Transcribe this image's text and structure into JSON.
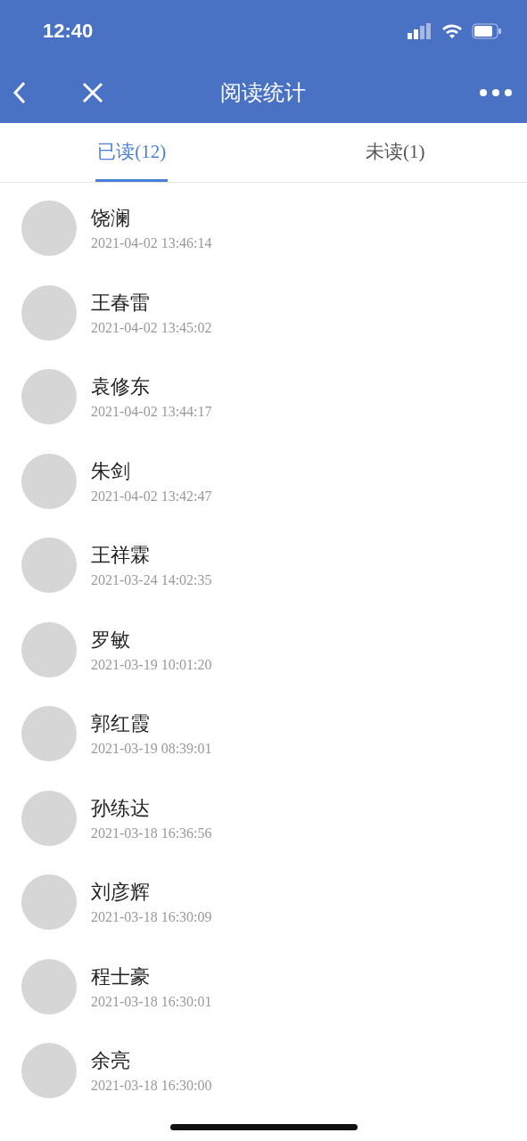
{
  "status_bar": {
    "time": "12:40"
  },
  "nav": {
    "title": "阅读统计"
  },
  "tabs": [
    {
      "label": "已读(12)",
      "selected": true
    },
    {
      "label": "未读(1)",
      "selected": false
    }
  ],
  "readers": [
    {
      "name": "饶澜",
      "time": "2021-04-02 13:46:14"
    },
    {
      "name": "王春雷",
      "time": "2021-04-02 13:45:02"
    },
    {
      "name": "袁修东",
      "time": "2021-04-02 13:44:17"
    },
    {
      "name": "朱剑",
      "time": "2021-04-02 13:42:47"
    },
    {
      "name": "王祥霖",
      "time": "2021-03-24 14:02:35"
    },
    {
      "name": "罗敏",
      "time": "2021-03-19 10:01:20"
    },
    {
      "name": "郭红霞",
      "time": "2021-03-19 08:39:01"
    },
    {
      "name": "孙练达",
      "time": "2021-03-18 16:36:56"
    },
    {
      "name": "刘彦辉",
      "time": "2021-03-18 16:30:09"
    },
    {
      "name": "程士豪",
      "time": "2021-03-18 16:30:01"
    },
    {
      "name": "余亮",
      "time": "2021-03-18 16:30:00"
    }
  ]
}
